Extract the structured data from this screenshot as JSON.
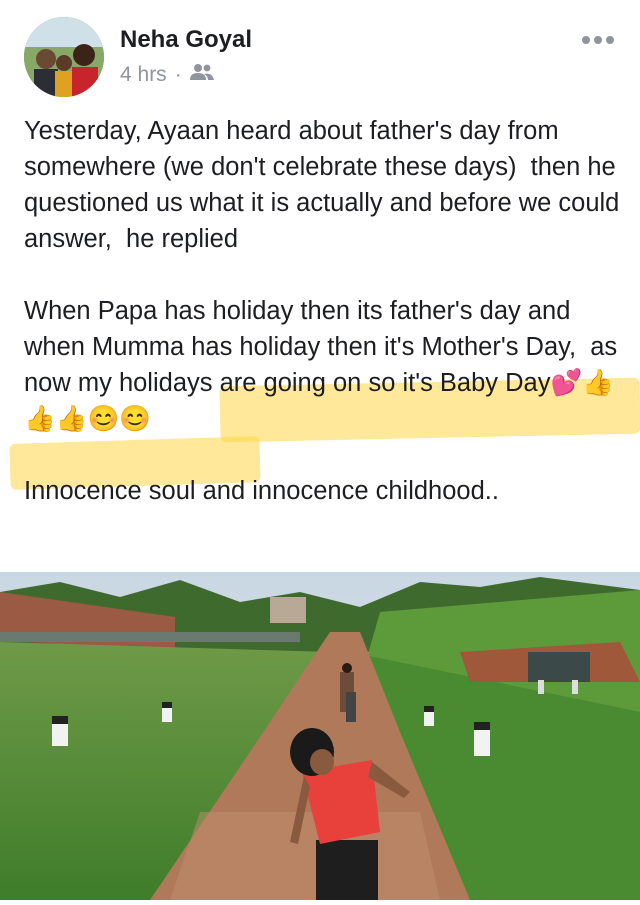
{
  "author": {
    "name": "Neha Goyal"
  },
  "post": {
    "time": "4 hrs",
    "separator": "·",
    "audience_icon": "friends-icon",
    "paragraph1": "Yesterday, Ayaan heard about father's day from somewhere (we don't celebrate these days)  then he questioned us what it is actually and before we could answer,  he replied",
    "paragraph2": "When Papa has holiday then its father's day and when Mumma has holiday then it's Mother's Day,  as now my holidays are going on so it's Baby Day💕👍👍👍😊😊",
    "paragraph3": "Innocence soul and innocence childhood..",
    "highlight_color": "#ffd646"
  },
  "icons": {
    "more": "more-options-icon"
  }
}
